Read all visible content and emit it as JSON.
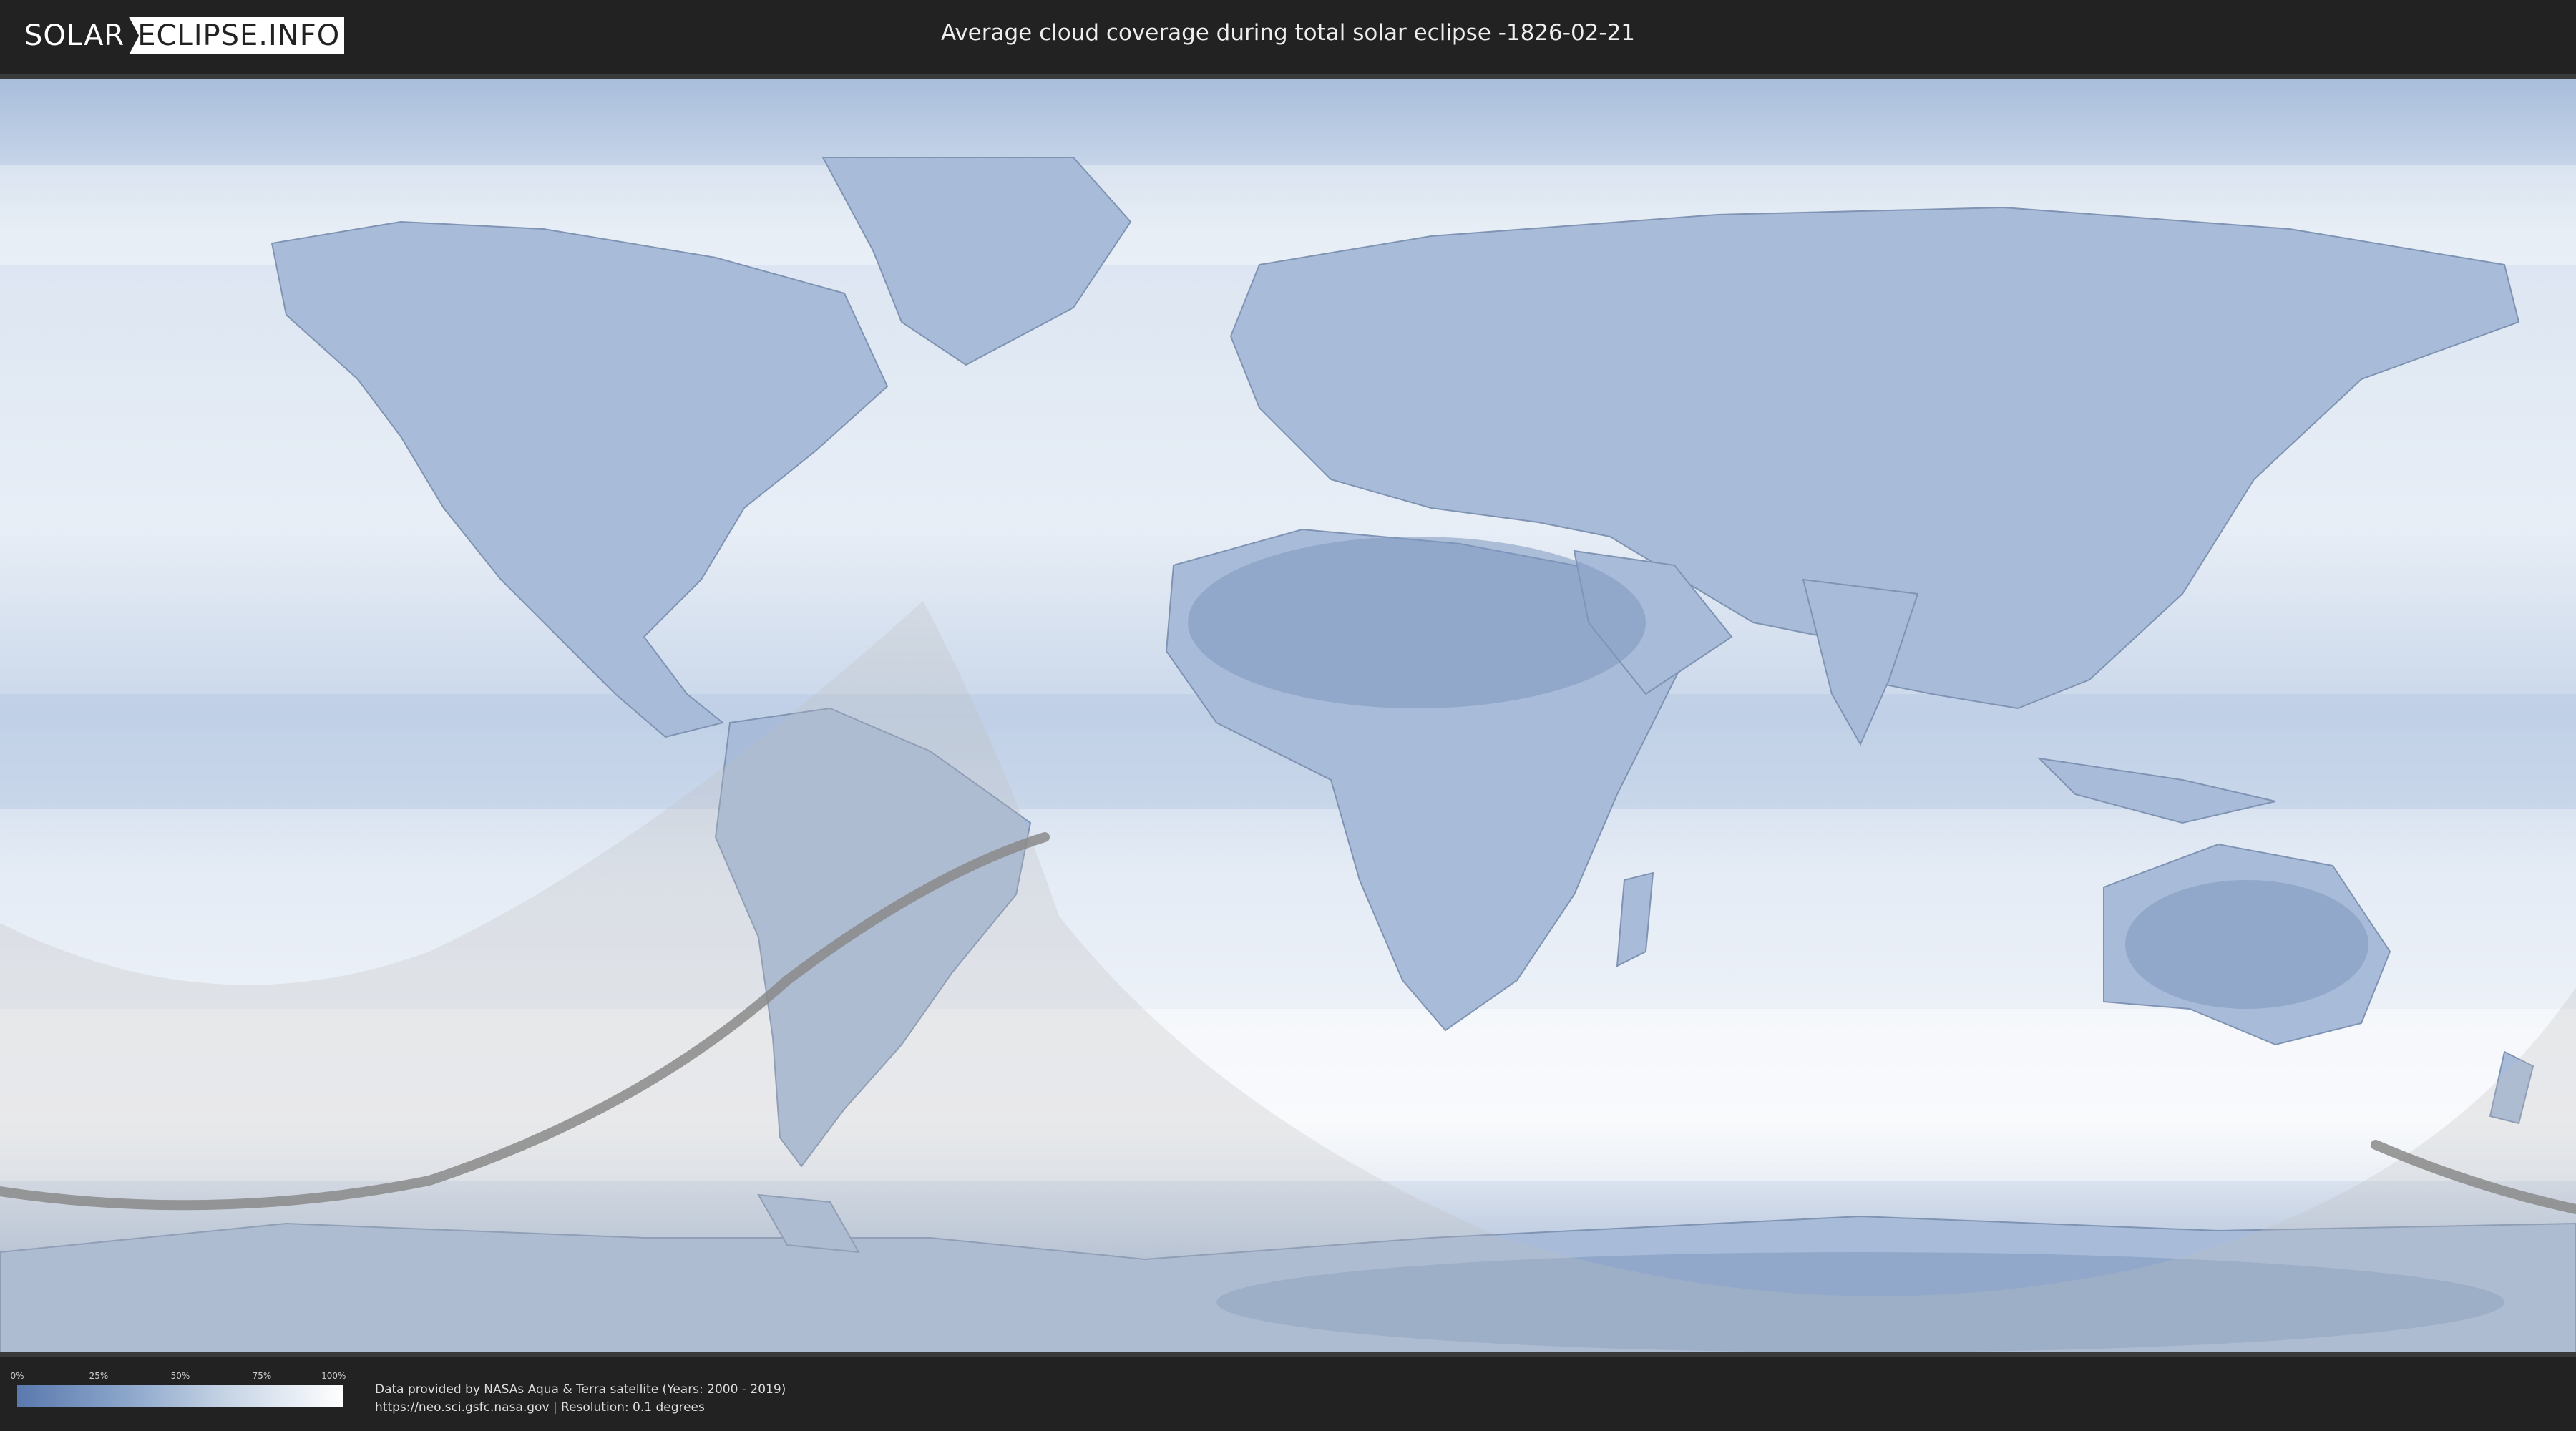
{
  "header": {
    "logo_left": "SOLAR",
    "logo_right": "ECLIPSE.INFO",
    "title": "Average cloud coverage during total solar eclipse -1826-02-21"
  },
  "map": {
    "ocean_color": "#dbe5f1",
    "land_color": "#9fb4d4",
    "penumbra_color": "#bdbdbd",
    "path_color": "#8a8a8a"
  },
  "legend": {
    "ticks": [
      "0%",
      "25%",
      "50%",
      "75%",
      "100%"
    ],
    "colors": [
      "#5a79ad",
      "#ffffff"
    ]
  },
  "credits": {
    "line1": "Data provided by NASAs Aqua & Terra satellite (Years: 2000 - 2019)",
    "line2": "https://neo.sci.gsfc.nasa.gov | Resolution: 0.1 degrees"
  }
}
